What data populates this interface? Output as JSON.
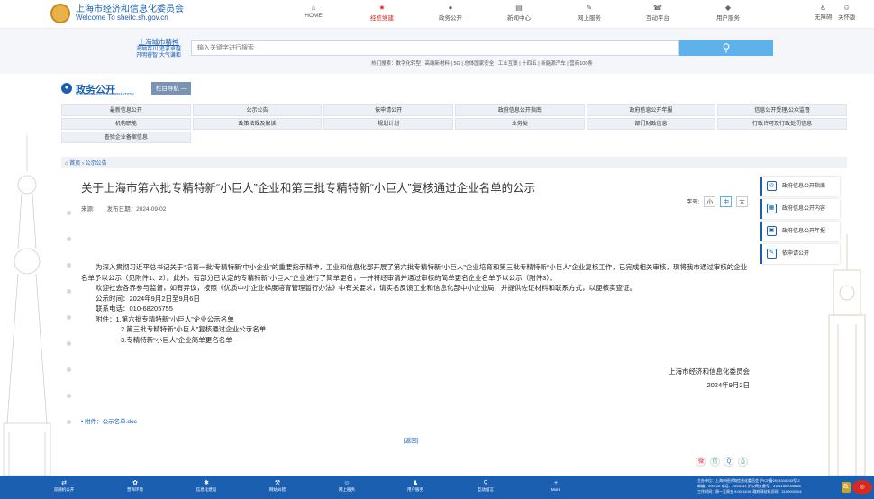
{
  "header": {
    "title": "上海市经济和信息化委员会",
    "subtitle": "Welcome To sheitc.sh.gov.cn",
    "nav": [
      {
        "icon": "⌂",
        "label": "HOME"
      },
      {
        "icon": "★",
        "label": "经信党建"
      },
      {
        "icon": "●",
        "label": "政务公开"
      },
      {
        "icon": "▤",
        "label": "新闻中心"
      },
      {
        "icon": "✎",
        "label": "网上服务"
      },
      {
        "icon": "☎",
        "label": "互动平台"
      },
      {
        "icon": "◆",
        "label": "用户服务"
      }
    ],
    "util": [
      "无障碍",
      "关怀版"
    ]
  },
  "brand": {
    "title": "上海城市精神",
    "line1": "海纳百川 追求卓越",
    "line2": "开明睿智 大气谦和"
  },
  "search": {
    "placeholder": "输入关键字进行搜索",
    "hot": "热门搜索：数字化转型 | 高端新材料 | 5G | 总体国家安全 | 工业互联 | 十四五 | 新能源汽车 | 营商100条"
  },
  "gov": {
    "title": "政务公开",
    "en": "GOVERNMENT INFORMATION",
    "nav_btn": "栏目导航 —"
  },
  "grid": [
    "最新信息公开",
    "公示公告",
    "依申请公开",
    "政府信息公开指南",
    "政府信息公开年报",
    "信息公开受理/公众监督",
    "机构职能",
    "政策法规及解读",
    "规划计划",
    "业务类",
    "部门财政信息",
    "行政许可及行政处罚信息",
    "查验企业备案信息"
  ],
  "breadcrumb": {
    "home": "首页",
    "sep": "›",
    "current": "公示公告"
  },
  "article": {
    "title": "关于上海市第六批专精特新“小巨人”企业和第三批专精特新“小巨人”复核通过企业名单的公示",
    "source_label": "来源:",
    "date": "发布日期：2024-09-02",
    "fontsize_label": "字号:",
    "fontsizes": [
      "小",
      "中",
      "大"
    ],
    "body": [
      "为深入贯彻习近平总书记关于“培育一批‘专精特新’中小企业”的重要指示精神，工业和信息化部开展了第六批专精特新“小巨人”企业培育和第三批专精特新“小巨人”企业复核工作，已完成相关审核，现将我市通过审核的企业名单予以公示（见附件1、2）。此外，有部分已认定的专精特新“小巨人”企业进行了简单更名，一并将经审请并通过审核的简单更名企业名单予以公示（附件3）。",
      "欢迎社会各界参与监督，如有异议，按照《优质中小企业梯度培育管理暂行办法》中有关要求，请实名反馈工业和信息化部中小企业局，并提供佐证材料和联系方式，以便核实查证。"
    ],
    "period": "公示时间：2024年9月2日至9月6日",
    "phone": "联系电话：010-68205755",
    "attach_title": "附件：1.第六批专精特新“小巨人”企业公示名单",
    "attach2": "2.第三批专精特新“小巨人”复核通过企业公示名单",
    "attach3": "3.专精特新“小巨人”企业简单更名名单",
    "signer": "上海市经济和信息化委员会",
    "sign_date": "2024年9月2日",
    "attach_file": "• 附件：公示名单.doc",
    "back": "[返回]"
  },
  "side": [
    {
      "icon": "◎",
      "label": "政府信息公开指南"
    },
    {
      "icon": "▦",
      "label": "政府信息公开内容"
    },
    {
      "icon": "▣",
      "label": "政府信息公开年报"
    },
    {
      "icon": "✎",
      "label": "依申请公开"
    }
  ],
  "footer": {
    "items": [
      {
        "icon": "⇄",
        "label": "双随机公开"
      },
      {
        "icon": "✿",
        "label": "营商环境"
      },
      {
        "icon": "✱",
        "label": "信息化建设"
      },
      {
        "icon": "⚒",
        "label": "网站纠错"
      },
      {
        "icon": "☺",
        "label": "网上服务"
      },
      {
        "icon": "♟",
        "label": "用户服务"
      },
      {
        "icon": "⚲",
        "label": "互动留言"
      },
      {
        "icon": "+",
        "label": "More"
      }
    ],
    "info1": "主办单位：上海市经济和信息化委员会  沪ICP备2021016243号-2",
    "info2": "邮编：200125  电话：23111111  沪公网安备号：31011502005566",
    "info3": "工作时间：周一至周五 9:00-18:00  政府网站标识码：3100000104"
  },
  "colors": {
    "brand": "#1b5fb1",
    "accent": "#d9281e",
    "search": "#5db2ec"
  }
}
